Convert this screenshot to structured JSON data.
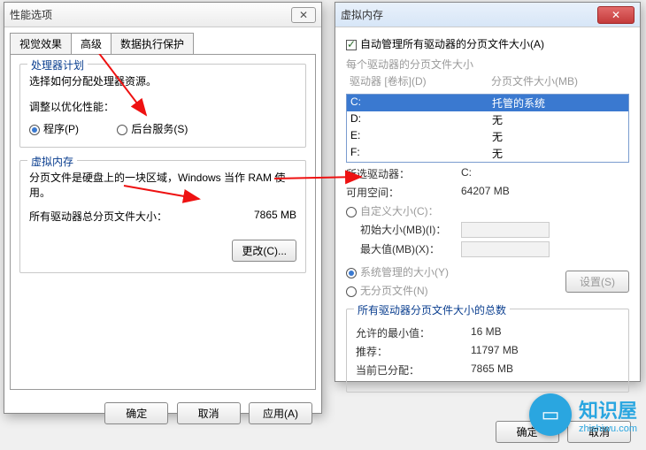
{
  "left": {
    "title": "性能选项",
    "tabs": {
      "visual": "视觉效果",
      "advanced": "高级",
      "dep": "数据执行保护"
    },
    "sched": {
      "title": "处理器计划",
      "desc": "选择如何分配处理器资源。",
      "adjust": "调整以优化性能：",
      "programs": "程序(P)",
      "services": "后台服务(S)"
    },
    "vm": {
      "title": "虚拟内存",
      "desc": "分页文件是硬盘上的一块区域，Windows 当作 RAM 使用。",
      "total_label": "所有驱动器总分页文件大小：",
      "total_value": "7865 MB",
      "change": "更改(C)..."
    },
    "buttons": {
      "ok": "确定",
      "cancel": "取消",
      "apply": "应用(A)"
    }
  },
  "right": {
    "title": "虚拟内存",
    "auto": "自动管理所有驱动器的分页文件大小(A)",
    "each": "每个驱动器的分页文件大小",
    "drv_header": {
      "drive": "驱动器 [卷标](D)",
      "size": "分页文件大小(MB)"
    },
    "drives": [
      {
        "d": "C:",
        "s": "托管的系统"
      },
      {
        "d": "D:",
        "s": "无"
      },
      {
        "d": "E:",
        "s": "无"
      },
      {
        "d": "F:",
        "s": "无"
      }
    ],
    "selected_drive_label": "所选驱动器：",
    "selected_drive": "C:",
    "avail_label": "可用空间：",
    "avail": "64207 MB",
    "custom": "自定义大小(C)：",
    "init": "初始大小(MB)(I)：",
    "max": "最大值(MB)(X)：",
    "sysman": "系统管理的大小(Y)",
    "none": "无分页文件(N)",
    "set": "设置(S)",
    "totals_title": "所有驱动器分页文件大小的总数",
    "min_label": "允许的最小值：",
    "min": "16 MB",
    "rec_label": "推荐：",
    "rec": "11797 MB",
    "cur_label": "当前已分配：",
    "cur": "7865 MB",
    "ok": "确定",
    "cancel": "取消"
  },
  "brand": {
    "name": "知识屋",
    "url": "zhishiwu.com"
  }
}
